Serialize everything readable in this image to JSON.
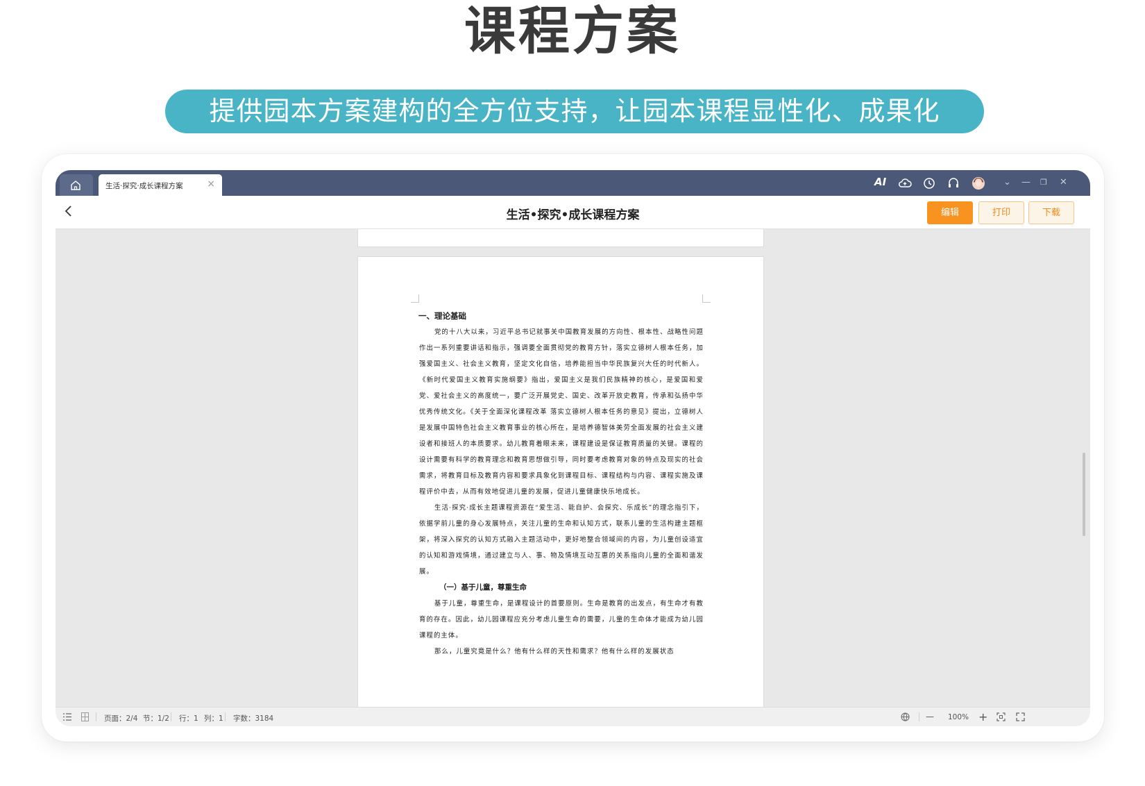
{
  "hero": {
    "title": "课程方案",
    "subtitle": "提供园本方案建构的全方位支持，让园本课程显性化、成果化"
  },
  "titlebar": {
    "tab_label": "生活·探究·成长课程方案",
    "tab_close": "×",
    "ai_label": "AI",
    "icons": [
      "home-icon",
      "ai-icon",
      "cloud-icon",
      "history-icon",
      "headset-icon",
      "avatar",
      "chevron-down-icon",
      "minimize-icon",
      "restore-icon",
      "close-icon"
    ]
  },
  "header": {
    "title": "生活•探究•成长课程方案",
    "edit_label": "编辑",
    "print_label": "打印",
    "download_label": "下载"
  },
  "document": {
    "heading1": "一、理论基础",
    "para1": "党的十八大以来，习近平总书记就事关中国教育发展的方向性、根本性、战略性问题作出一系列重要讲话和指示，强调要全面贯彻党的教育方针，落实立德树人根本任务，加强爱国主义、社会主义教育，坚定文化自信，培养能担当中华民族复兴大任的时代新人。《新时代爱国主义教育实施纲要》指出，爱国主义是我们民族精神的核心，是爱国和爱党、爱社会主义的高度统一，要广泛开展党史、国史、改革开放史教育，传承和弘扬中华优秀传统文化。《关于全面深化课程改革 落实立德树人根本任务的意见》提出，立德树人是发展中国特色社会主义教育事业的核心所在，是培养德智体美劳全面发展的社会主义建设者和接班人的本质要求。幼儿教育着眼未来，课程建设是保证教育质量的关键。课程的设计需要有科学的教育理念和教育思想做引导，同时要考虑教育对象的特点及现实的社会需求，将教育目标及教育内容和要求具象化到课程目标、课程结构与内容、课程实施及课程评价中去，从而有效地促进儿童的发展，促进儿童健康快乐地成长。",
    "para2": "生活·探究·成长主题课程资源在“爱生活、能自护、会探究、乐成长”的理念指引下，依据学前儿童的身心发展特点，关注儿童的生命和认知方式，联系儿童的生活构建主题框架，将深入探究的认知方式融入主题活动中，更好地整合领域间的内容，为儿童创设适宜的认知和游戏情境，通过建立与人、事、物及情境互动互惠的关系指向儿童的全面和谐发展。",
    "heading2": "（一）基于儿童，尊重生命",
    "para3": "基于儿童，尊重生命，是课程设计的首要原则。生命是教育的出发点，有生命才有教育的存在。因此，幼儿园课程应充分考虑儿童生命的需要，儿童的生命体才能成为幼儿园课程的主体。",
    "para4": "那么，儿童究竟是什么？他有什么样的天性和需求？他有什么样的发展状态"
  },
  "statusbar": {
    "page": "页面：2/4",
    "section": "节：1/2",
    "row": "行：1",
    "col": "列：1",
    "word_count": "字数：3184",
    "zoom": "100%",
    "zoom_out": "—",
    "zoom_in": "+"
  },
  "colors": {
    "titlebar": "#4b5877",
    "accent_orange": "#f7931e",
    "pill": "#49b4c5"
  }
}
